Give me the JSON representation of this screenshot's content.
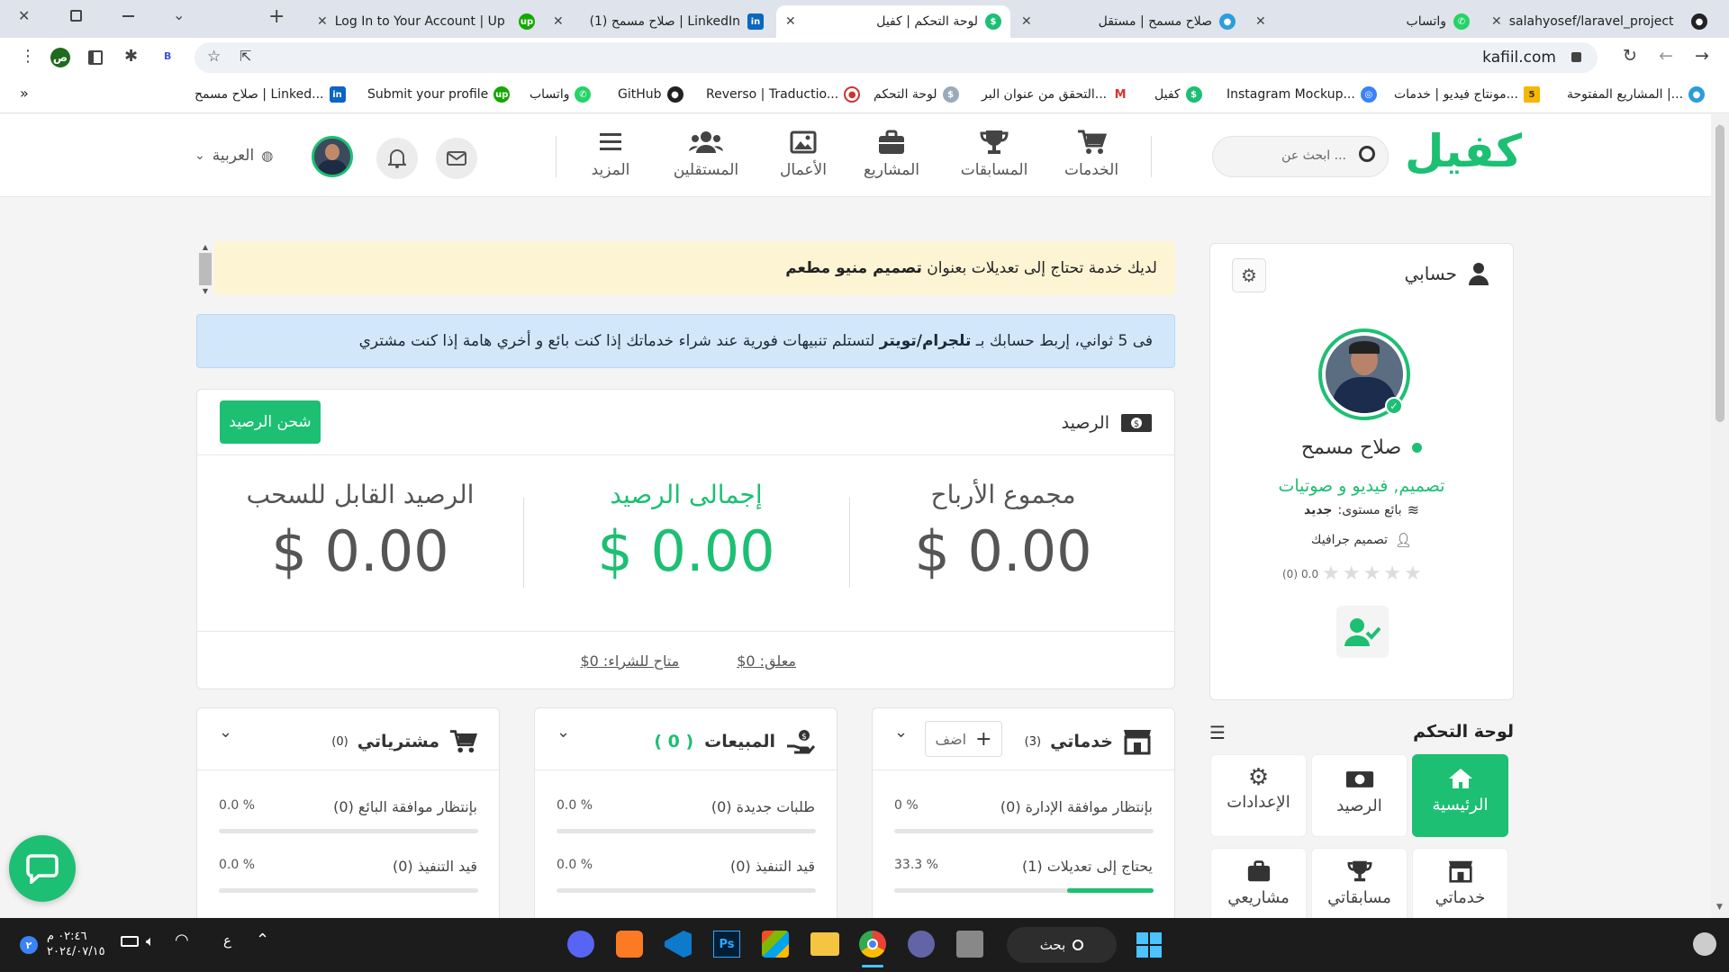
{
  "browser": {
    "tabs": [
      {
        "label": "salahyosef/laravel_project",
        "icon": "github-icon"
      },
      {
        "label": "واتساب",
        "icon": "whatsapp-icon"
      },
      {
        "label": "صلاح مسمح | مستقل",
        "icon": "mostaql-icon"
      },
      {
        "label": "لوحة التحكم | كفيل",
        "icon": "kafiil-icon"
      },
      {
        "label": "(1) صلاح مسمح | LinkedIn",
        "icon": "linkedin-icon"
      },
      {
        "label": "Log In to Your Account | Up",
        "icon": "upwork-icon"
      }
    ],
    "url": "kafiil.com",
    "profile_initial": "ص",
    "ext_label": "B",
    "bookmarks": [
      {
        "label": "المشاريع المفتوحة |...",
        "icon": "circle-icon"
      },
      {
        "label": "مونتاج فيديو | خدمات...",
        "icon": "khamsat-icon"
      },
      {
        "label": "Instagram Mockup...",
        "icon": "globe-icon"
      },
      {
        "label": "كفيل",
        "icon": "kafiil-icon"
      },
      {
        "label": "التحقق من عنوان البر...",
        "icon": "gmail-icon"
      },
      {
        "label": "لوحة التحكم",
        "icon": "kafiil-icon"
      },
      {
        "label": "Reverso | Traductio...",
        "icon": "reverso-icon"
      },
      {
        "label": "GitHub",
        "icon": "github-icon"
      },
      {
        "label": "واتساب",
        "icon": "whatsapp-icon"
      },
      {
        "label": "Submit your profile",
        "icon": "upwork-icon"
      },
      {
        "label": "صلاح مسمح | Linked...",
        "icon": "linkedin-icon"
      }
    ],
    "more": "»"
  },
  "header": {
    "logo": "كفيل",
    "search_placeholder": "ابحث عن ...",
    "nav": [
      "الخدمات",
      "المسابقات",
      "المشاريع",
      "الأعمال",
      "المستقلين",
      "المزيد"
    ],
    "language": "العربية"
  },
  "alerts": {
    "yellow_prefix": "لديك خدمة تحتاج إلى تعديلات بعنوان ",
    "yellow_bold": "تصميم منيو مطعم",
    "blue_prefix": "فى 5 ثواني، إربط حسابك بـ ",
    "blue_bold": "تلجرام/تويتر",
    "blue_suffix": " لتستلم تنبيهات فورية عند شراء خدماتك إذا كنت بائع و أخري هامة إذا كنت مشتري"
  },
  "balance": {
    "title": "الرصيد",
    "charge_button": "شحن الرصيد",
    "earnings_label": "مجموع الأرباح",
    "earnings_value": "$ 0.00",
    "total_label": "إجمالى الرصيد",
    "total_value": "$ 0.00",
    "withdrawable_label": "الرصيد القابل للسحب",
    "withdrawable_value": "$ 0.00",
    "pending": "معلق: 0$",
    "available": "متاح للشراء: 0$"
  },
  "services": {
    "title": "خدماتي",
    "count": "(3)",
    "add": "اضف",
    "rows": [
      {
        "label": "بإنتظار موافقة الإدارة (0)",
        "percent": "0 %",
        "fill": 0
      },
      {
        "label": "يحتاج إلى تعديلات (1)",
        "percent": "33.3 %",
        "fill": 33.3
      }
    ]
  },
  "sales": {
    "title": "المبيعات",
    "count": "( 0 )",
    "rows": [
      {
        "label": "طلبات جديدة (0)",
        "percent": "0.0 %",
        "fill": 0
      },
      {
        "label": "قيد التنفيذ (0)",
        "percent": "0.0 %",
        "fill": 0
      }
    ]
  },
  "purchases": {
    "title": "مشترياتي",
    "count": "(0)",
    "rows": [
      {
        "label": "بإنتظار موافقة البائع (0)",
        "percent": "0.0 %",
        "fill": 0
      },
      {
        "label": "قيد التنفيذ (0)",
        "percent": "0.0 %",
        "fill": 0
      }
    ]
  },
  "profile": {
    "title": "حسابي",
    "name": "صلاح مسمح",
    "specialty": "تصميم, فيديو و صوتيات",
    "level_label": "بائع مستوى:",
    "level_value": "جديد",
    "category": "تصميم جرافيك",
    "rating": "0.0",
    "reviews": "(0)",
    "stars": 0
  },
  "dashboard": {
    "title": "لوحة التحكم",
    "tiles": [
      {
        "label": "الرئيسية",
        "icon": "home-icon"
      },
      {
        "label": "الرصيد",
        "icon": "money-icon"
      },
      {
        "label": "الإعدادات",
        "icon": "gear-icon"
      },
      {
        "label": "خدماتي",
        "icon": "store-icon"
      },
      {
        "label": "مسابقاتي",
        "icon": "trophy-icon"
      },
      {
        "label": "مشاريعي",
        "icon": "briefcase-icon"
      }
    ]
  },
  "taskbar": {
    "search": "بحث",
    "time": "٠٢:٤٦ م",
    "date": "٢٠٢٤/٠٧/١٥",
    "lang": "ع",
    "badge": "٢"
  },
  "colors": {
    "brand": "#1dbf73",
    "yellow_alert": "#fdf4d3",
    "blue_alert": "#d2e7fa"
  }
}
